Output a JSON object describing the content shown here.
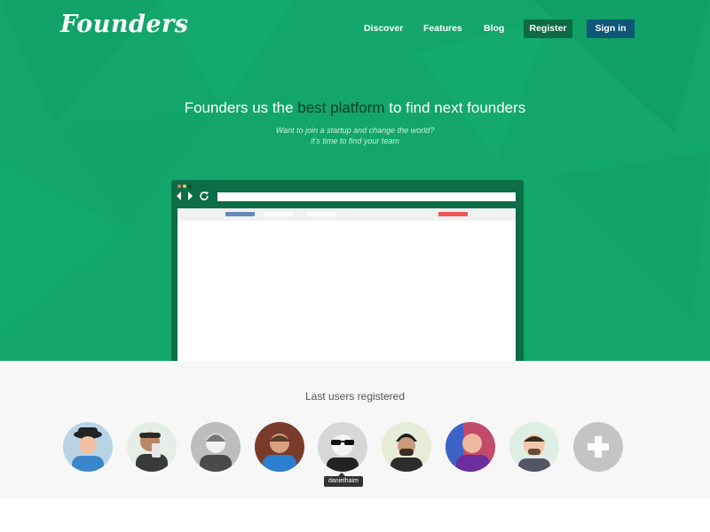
{
  "brand": {
    "logo": "Founders"
  },
  "nav": {
    "links": [
      "Discover",
      "Features",
      "Blog"
    ],
    "register": "Register",
    "signin": "Sign in"
  },
  "hero": {
    "headline_pre": "Founders us the ",
    "headline_highlight": "best platform",
    "headline_post": " to find next founders",
    "sub1": "Want to join a startup and change the world?",
    "sub2": "it's time to find your team"
  },
  "users": {
    "title": "Last users registered",
    "tooltip": "danielhaim"
  },
  "colors": {
    "hero_green": "#12a66a",
    "register_button": "#0b6b45",
    "signin_button": "#0d5778",
    "highlight_text": "#0b3d28"
  },
  "icons": {
    "add_user": "plus-icon",
    "reload": "refresh-icon",
    "navigation": "arrow-icons"
  }
}
